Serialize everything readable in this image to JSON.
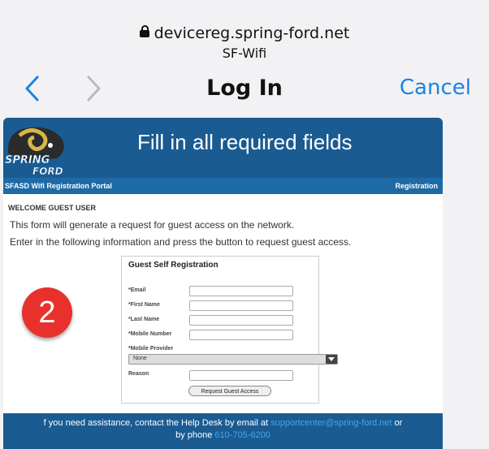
{
  "browser": {
    "url": "devicereg.spring-ford.net",
    "subtitle": "SF-Wifi",
    "title": "Log In",
    "cancel_label": "Cancel"
  },
  "portal": {
    "logo_text_1": "SPRING",
    "logo_text_2": "FORD",
    "header_title": "Fill in all required fields",
    "subbar_left": "SFASD Wifi Registration Portal",
    "subbar_right": "Registration",
    "welcome": "WELCOME GUEST USER",
    "line1": "This form will generate a request for guest access on the network.",
    "line2": "Enter in the following information and press the button to request guest access.",
    "form": {
      "title": "Guest Self Registration",
      "email_label": "*Email",
      "first_name_label": "*First Name",
      "last_name_label": "*Last Name",
      "mobile_number_label": "*Mobile Number",
      "mobile_provider_label": "*Mobile Provider",
      "provider_selected": "None",
      "reason_label": "Reason",
      "submit_label": "Request Guest Access"
    },
    "footer": {
      "text_a": "f you need assistance, contact the Help Desk by email at",
      "email": "supportcenter@spring-ford.net",
      "text_b": "or",
      "text_c": "by phone",
      "phone": "610-705-6200"
    }
  },
  "badge": {
    "number": "2"
  },
  "colors": {
    "accent": "#1a82e6",
    "header_blue": "#1a5b92",
    "badge_red": "#e8312c"
  }
}
